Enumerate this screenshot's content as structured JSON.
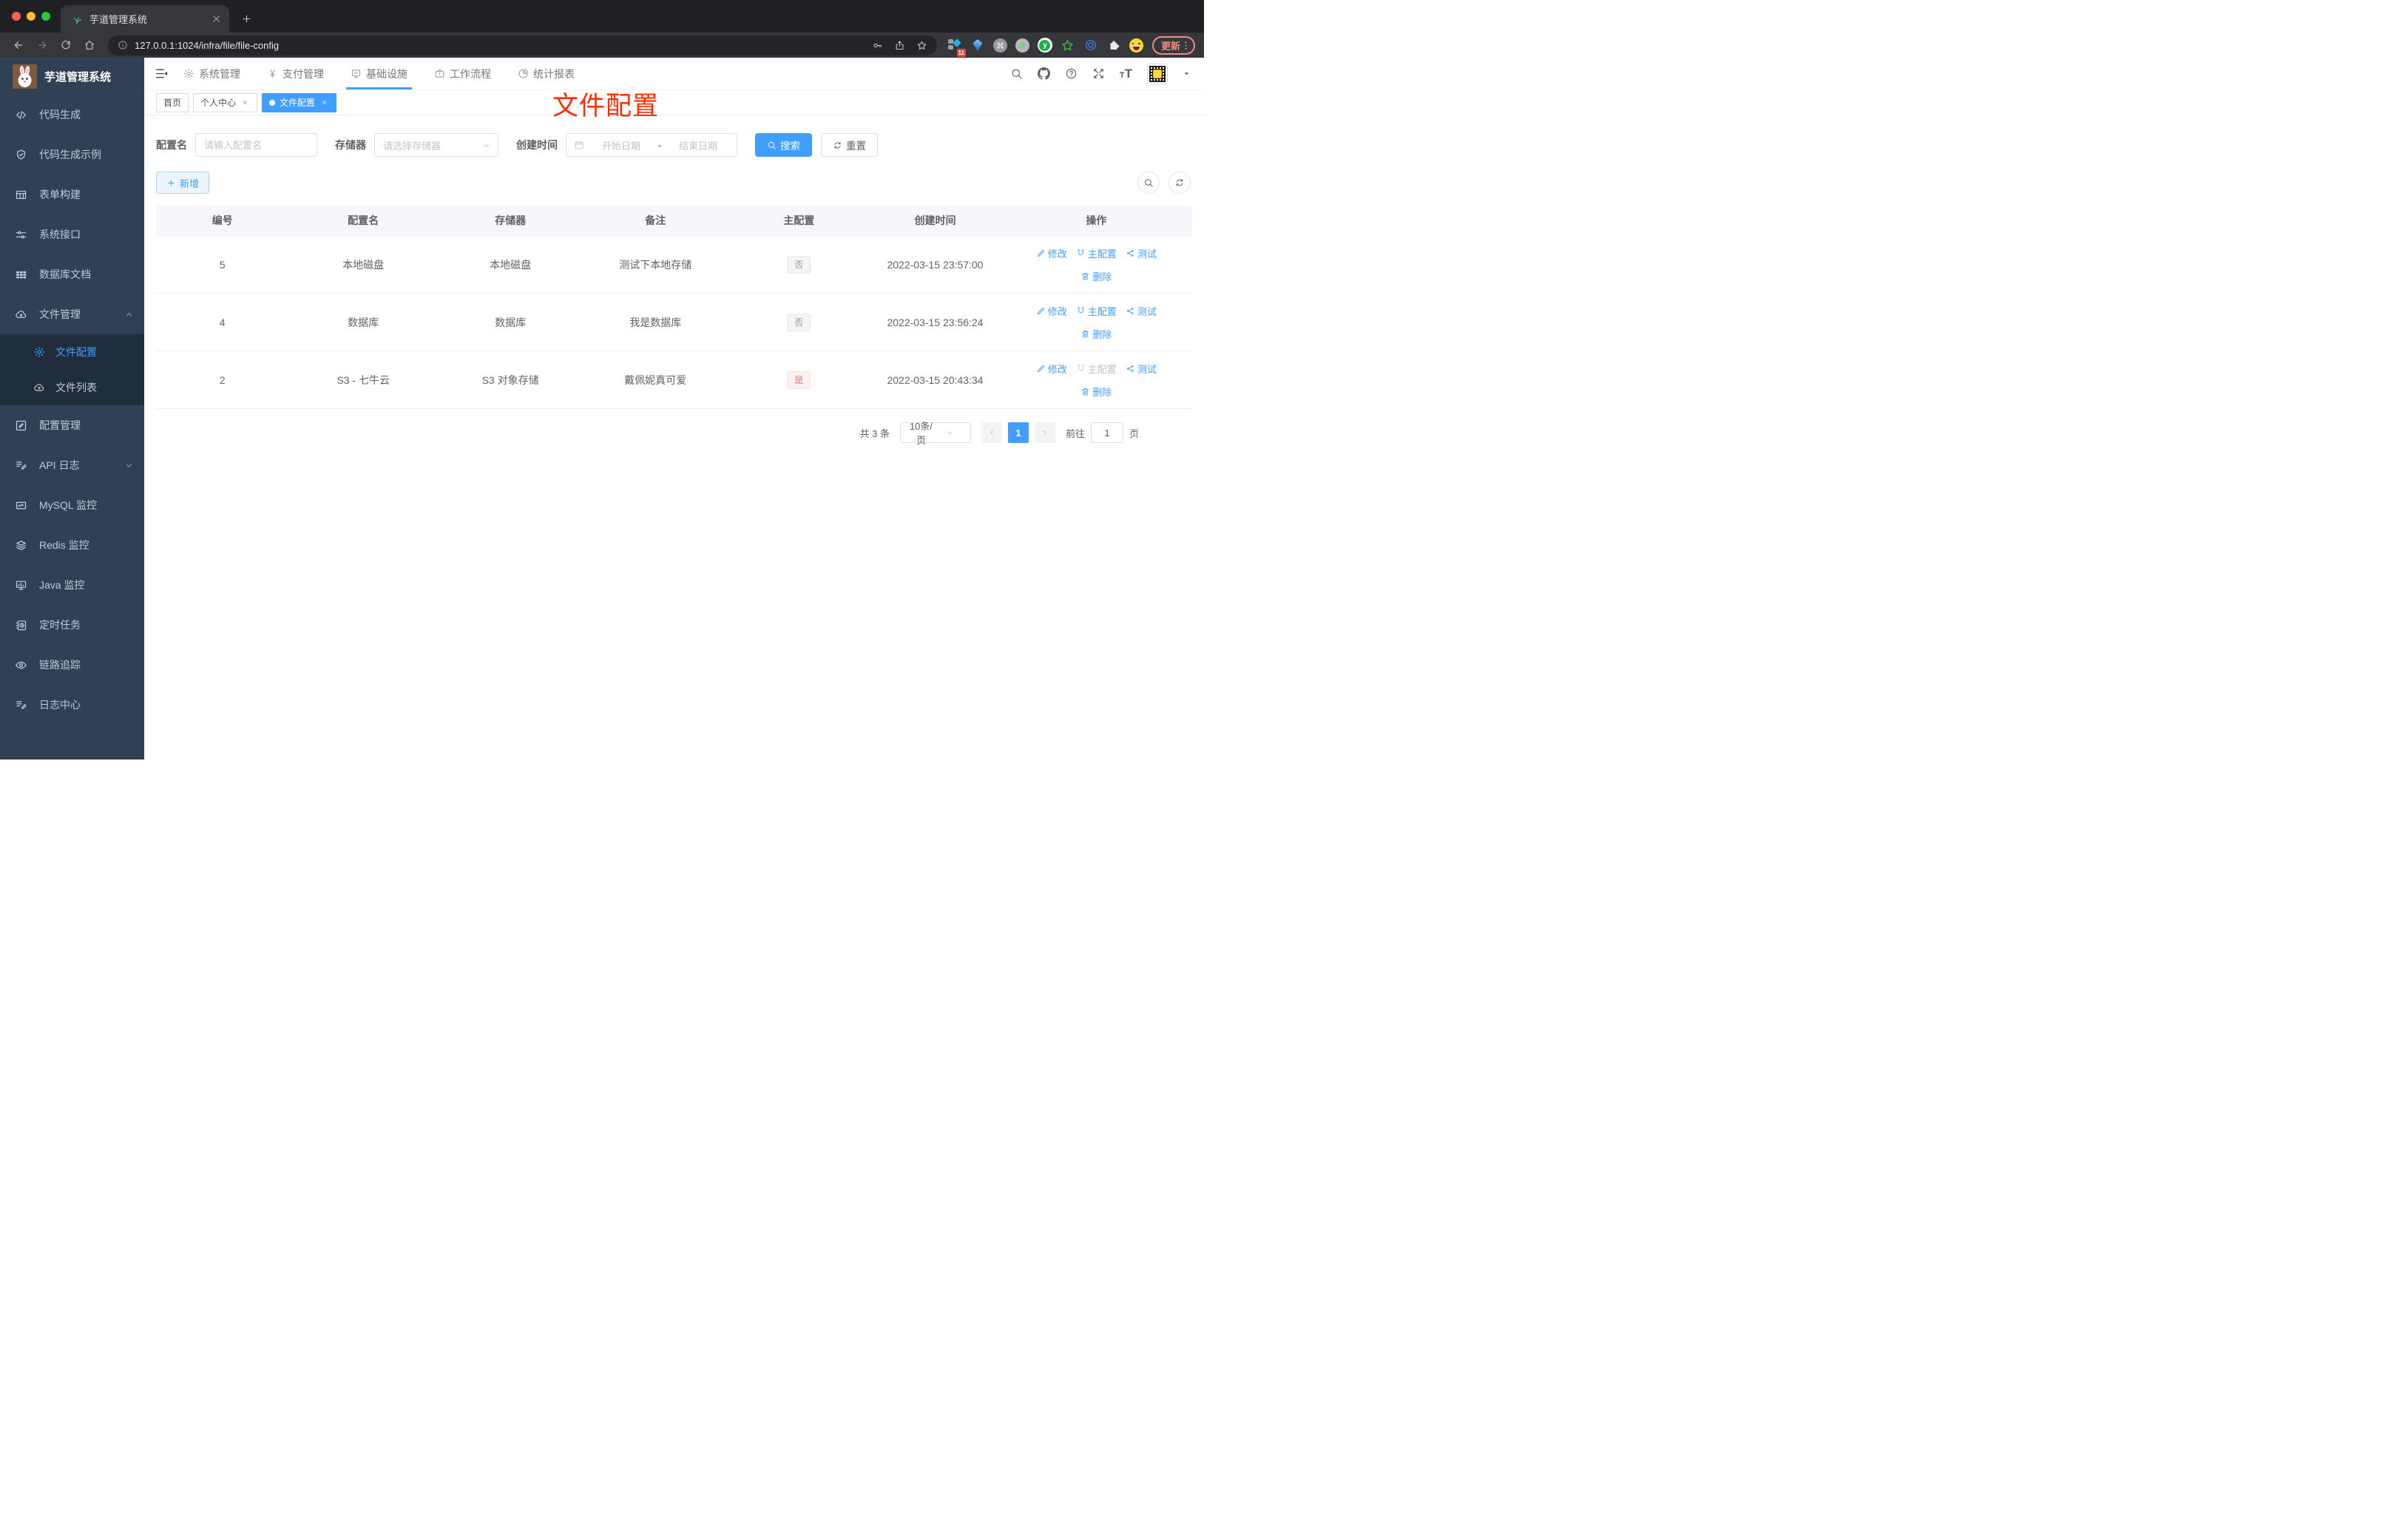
{
  "browser": {
    "tab_title": "芋道管理系统",
    "url": "127.0.0.1:1024/infra/file/file-config",
    "update_label": "更新",
    "extension_badge": "11"
  },
  "app": {
    "logo_title": "芋道管理系统",
    "nav": {
      "items": [
        {
          "key": "system",
          "icon": "gear",
          "label": "系统管理"
        },
        {
          "key": "pay",
          "icon": "yen",
          "label": "支付管理"
        },
        {
          "key": "infra",
          "icon": "monitor-check",
          "label": "基础设施",
          "active": true
        },
        {
          "key": "workflow",
          "icon": "briefcase",
          "label": "工作流程"
        },
        {
          "key": "report",
          "icon": "pie",
          "label": "统计报表"
        }
      ]
    },
    "sidebar": {
      "items": [
        {
          "key": "code-gen",
          "icon": "code",
          "label": "代码生成"
        },
        {
          "key": "code-demo",
          "icon": "shield-check",
          "label": "代码生成示例"
        },
        {
          "key": "form-build",
          "icon": "form",
          "label": "表单构建"
        },
        {
          "key": "system-api",
          "icon": "sliders",
          "label": "系统接口"
        },
        {
          "key": "db-doc",
          "icon": "grid",
          "label": "数据库文档"
        },
        {
          "key": "file-manage",
          "icon": "cloud-down",
          "label": "文件管理",
          "expanded": true,
          "children": [
            {
              "key": "file-config",
              "icon": "gear",
              "label": "文件配置",
              "active": true
            },
            {
              "key": "file-list",
              "icon": "cloud-up",
              "label": "文件列表"
            }
          ]
        },
        {
          "key": "config-manage",
          "icon": "edit-square",
          "label": "配置管理"
        },
        {
          "key": "api-log",
          "icon": "doc-pen",
          "label": "API 日志",
          "collapsible": true
        },
        {
          "key": "mysql-monitor",
          "icon": "chart",
          "label": "MySQL 监控"
        },
        {
          "key": "redis-monitor",
          "icon": "layers",
          "label": "Redis 监控"
        },
        {
          "key": "java-monitor",
          "icon": "monitor-bars",
          "label": "Java 监控"
        },
        {
          "key": "scheduled-job",
          "icon": "clock-doc",
          "label": "定时任务"
        },
        {
          "key": "tracing",
          "icon": "eye",
          "label": "链路追踪"
        },
        {
          "key": "log-center",
          "icon": "doc-pen",
          "label": "日志中心"
        }
      ]
    },
    "tags": [
      {
        "key": "home",
        "label": "首页"
      },
      {
        "key": "profile",
        "label": "个人中心",
        "closable": true
      },
      {
        "key": "file-config",
        "label": "文件配置",
        "closable": true,
        "active": true
      }
    ],
    "annotation": "文件配置",
    "filter": {
      "name_label": "配置名",
      "name_placeholder": "请输入配置名",
      "storage_label": "存储器",
      "storage_placeholder": "请选择存储器",
      "date_label": "创建时间",
      "date_start_placeholder": "开始日期",
      "date_separator": "-",
      "date_end_placeholder": "结束日期",
      "search_label": "搜索",
      "reset_label": "重置"
    },
    "add_button": "新增",
    "table": {
      "columns": [
        "编号",
        "配置名",
        "存储器",
        "备注",
        "主配置",
        "创建时间",
        "操作"
      ],
      "rows": [
        {
          "id": "5",
          "name": "本地磁盘",
          "storage": "本地磁盘",
          "remark": "测试下本地存储",
          "primary": "否",
          "primary_type": "info",
          "created": "2022-03-15 23:57:00",
          "actions": [
            {
              "key": "edit",
              "icon": "pencil",
              "label": "修改"
            },
            {
              "key": "primary",
              "icon": "magnet",
              "label": "主配置"
            },
            {
              "key": "test",
              "icon": "share",
              "label": "测试"
            },
            {
              "key": "delete",
              "icon": "trash",
              "label": "删除"
            }
          ]
        },
        {
          "id": "4",
          "name": "数据库",
          "storage": "数据库",
          "remark": "我是数据库",
          "primary": "否",
          "primary_type": "info",
          "created": "2022-03-15 23:56:24",
          "actions": [
            {
              "key": "edit",
              "icon": "pencil",
              "label": "修改"
            },
            {
              "key": "primary",
              "icon": "magnet",
              "label": "主配置"
            },
            {
              "key": "test",
              "icon": "share",
              "label": "测试"
            },
            {
              "key": "delete",
              "icon": "trash",
              "label": "删除"
            }
          ]
        },
        {
          "id": "2",
          "name": "S3 - 七牛云",
          "storage": "S3 对象存储",
          "remark": "戴佩妮真可爱",
          "primary": "是",
          "primary_type": "danger",
          "created": "2022-03-15 20:43:34",
          "actions": [
            {
              "key": "edit",
              "icon": "pencil",
              "label": "修改"
            },
            {
              "key": "primary",
              "icon": "magnet",
              "label": "主配置",
              "disabled": true
            },
            {
              "key": "test",
              "icon": "share",
              "label": "测试"
            },
            {
              "key": "delete",
              "icon": "trash",
              "label": "删除"
            }
          ]
        }
      ]
    },
    "pagination": {
      "total": "共 3 条",
      "page_size": "10条/页",
      "current_page": "1",
      "goto_label": "前往",
      "goto_value": "1",
      "page_unit": "页"
    }
  },
  "colors": {
    "accent": "#409eff",
    "sidebar_bg": "#304156",
    "submenu_bg": "#1f2d3d",
    "danger": "#f56c6c",
    "annotation_red": "#ff2d00"
  }
}
